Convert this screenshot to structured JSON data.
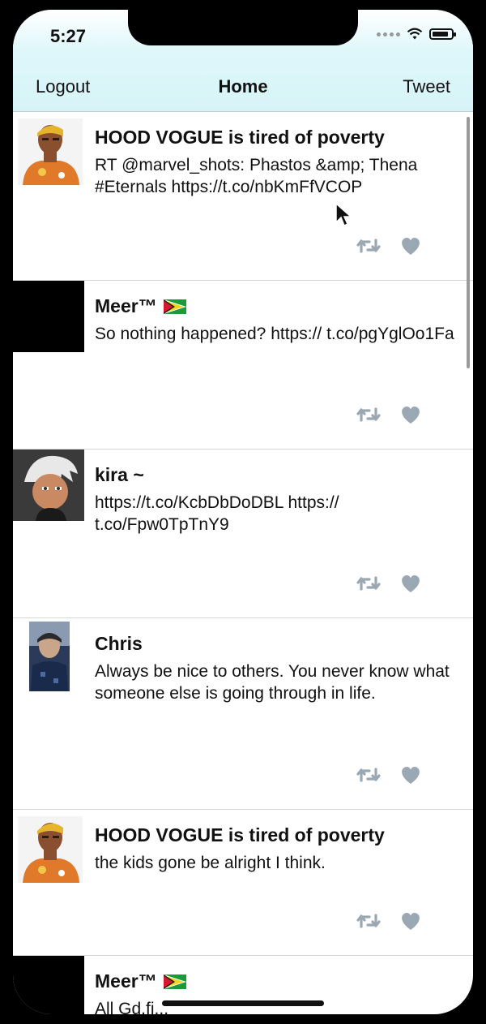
{
  "status": {
    "time": "5:27",
    "battery_level": 0.85
  },
  "nav": {
    "left": "Logout",
    "title": "Home",
    "right": "Tweet"
  },
  "tweets": [
    {
      "name": "HOOD VOGUE is tired of poverty",
      "text": "RT @marvel_shots: Phastos &amp; Thena #Eternals https://t.co/nbKmFfVCOP",
      "avatar": "cartoon-avatar-orange"
    },
    {
      "name": "Meer™",
      "has_flag": true,
      "text": "So nothing happened? https:// t.co/pgYglOo1Fa",
      "avatar": "black-square-avatar"
    },
    {
      "name": "kira ~",
      "text": "https://t.co/KcbDbDoDBL https:// t.co/Fpw0TpTnY9",
      "avatar": "cartoon-ghost-avatar"
    },
    {
      "name": "Chris",
      "text": "Always be nice to others. You never know what someone else is going through in life.",
      "avatar": "photo-avatar"
    },
    {
      "name": "HOOD VOGUE is tired of poverty",
      "text": "the kids gone be alright I think.",
      "avatar": "cartoon-avatar-orange"
    },
    {
      "name": "Meer™",
      "has_flag": true,
      "text": "All Gd.fi...",
      "avatar": "black-square-avatar"
    }
  ],
  "colors": {
    "icon_gray": "#9aa8b4",
    "nav_bg": "#d6f4f8"
  }
}
